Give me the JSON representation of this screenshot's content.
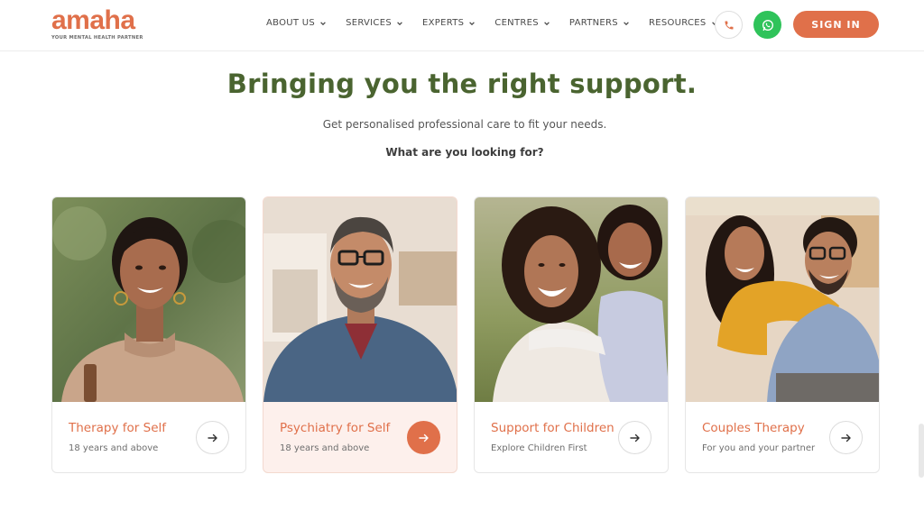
{
  "brand": {
    "logo_text": "amaha",
    "tagline": "YOUR MENTAL HEALTH PARTNER",
    "accent": "#e0704a",
    "green": "#4a6430",
    "whatsapp": "#2fc35a"
  },
  "nav": {
    "items": [
      {
        "label": "ABOUT US"
      },
      {
        "label": "SERVICES"
      },
      {
        "label": "EXPERTS"
      },
      {
        "label": "CENTRES"
      },
      {
        "label": "PARTNERS"
      },
      {
        "label": "RESOURCES"
      }
    ],
    "sign_in": "SIGN IN"
  },
  "hero": {
    "title": "Bringing you the right support.",
    "subtitle": "Get personalised professional care to fit your needs.",
    "question": "What are you looking for?"
  },
  "cards": [
    {
      "title": "Therapy for Self",
      "subtitle": "18 years and above",
      "icon": "arrow-right-icon"
    },
    {
      "title": "Psychiatry for Self",
      "subtitle": "18 years and above",
      "icon": "arrow-right-icon"
    },
    {
      "title": "Support for Children",
      "subtitle": "Explore Children First",
      "icon": "arrow-right-icon"
    },
    {
      "title": "Couples Therapy",
      "subtitle": "For you and your partner",
      "icon": "arrow-right-icon"
    }
  ]
}
